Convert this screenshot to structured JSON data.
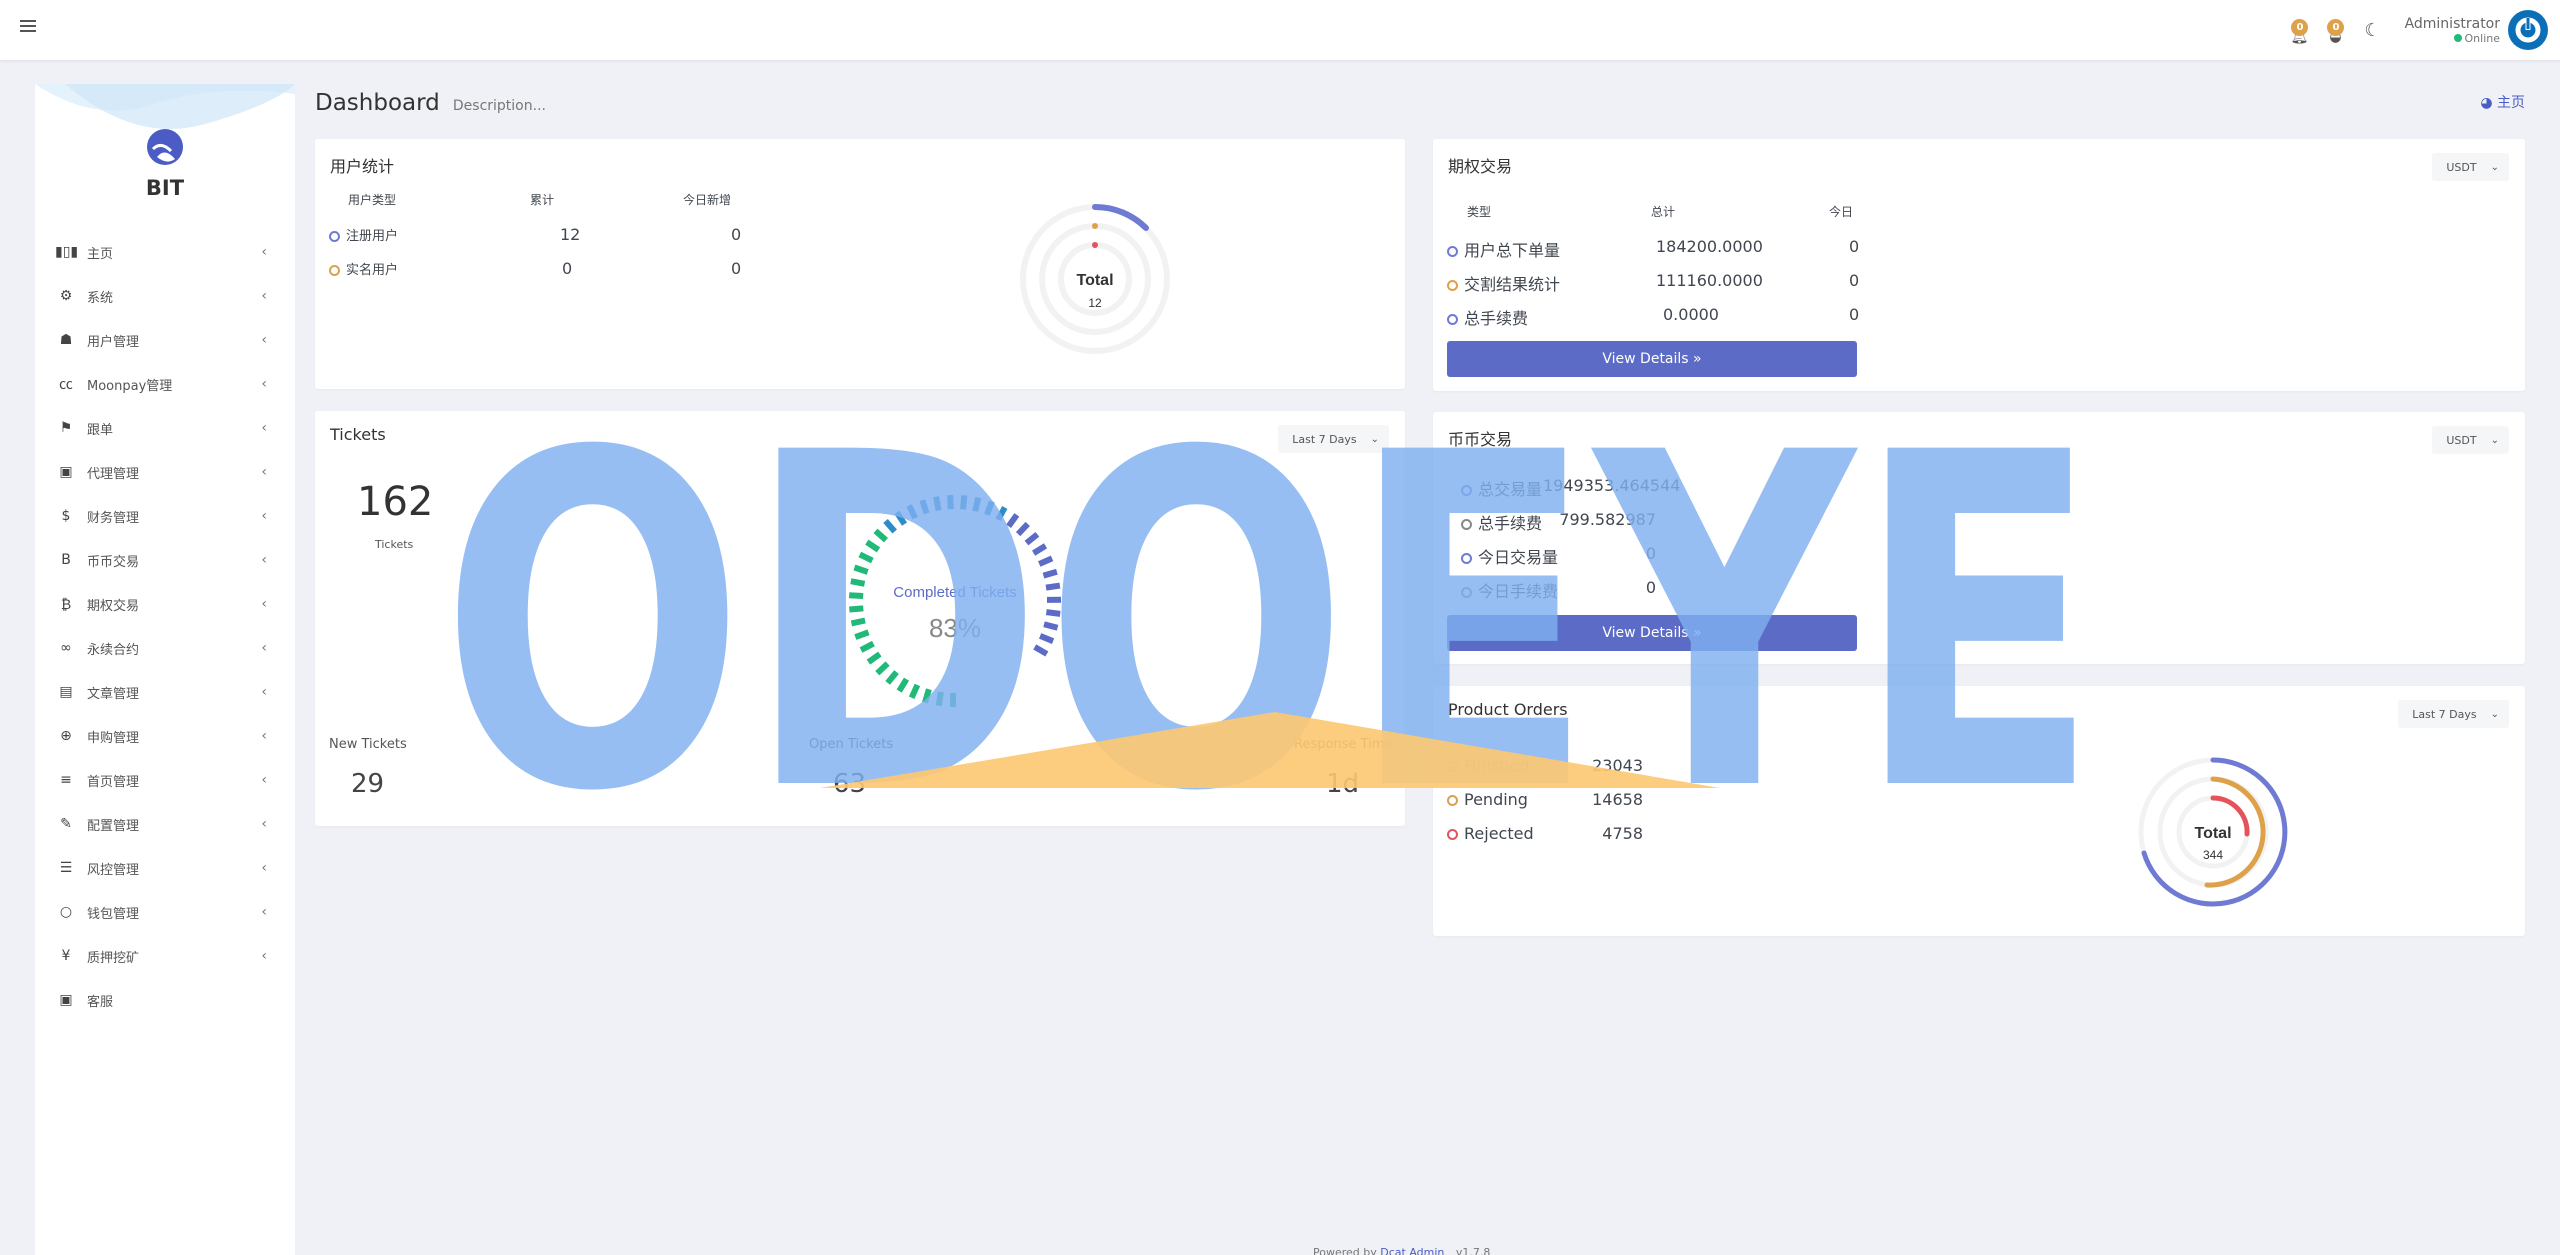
{
  "navbar": {
    "notifications_count": "0",
    "messages_count": "0",
    "user_name": "Administrator",
    "user_status": "Online"
  },
  "sidebar": {
    "brand": "BIT",
    "items": [
      {
        "label": "主页",
        "icon": "bar-chart-icon",
        "glyph": "▮▯▮",
        "has_children": true
      },
      {
        "label": "系统",
        "icon": "gear-icon",
        "glyph": "⚙",
        "has_children": true
      },
      {
        "label": "用户管理",
        "icon": "user-icon",
        "glyph": "☗",
        "has_children": true
      },
      {
        "label": "Moonpay管理",
        "icon": "cc-icon",
        "glyph": "㏄",
        "has_children": true
      },
      {
        "label": "跟单",
        "icon": "flag-icon",
        "glyph": "⚑",
        "has_children": true
      },
      {
        "label": "代理管理",
        "icon": "id-card-icon",
        "glyph": "▣",
        "has_children": true
      },
      {
        "label": "财务管理",
        "icon": "dollar-icon",
        "glyph": "$",
        "has_children": true
      },
      {
        "label": "币币交易",
        "icon": "b-icon",
        "glyph": "B",
        "has_children": true
      },
      {
        "label": "期权交易",
        "icon": "bitcoin-icon",
        "glyph": "₿",
        "has_children": true
      },
      {
        "label": "永续合约",
        "icon": "link-icon",
        "glyph": "∞",
        "has_children": true
      },
      {
        "label": "文章管理",
        "icon": "newspaper-icon",
        "glyph": "▤",
        "has_children": true
      },
      {
        "label": "申购管理",
        "icon": "life-ring-icon",
        "glyph": "⊕",
        "has_children": true
      },
      {
        "label": "首页管理",
        "icon": "bars-icon",
        "glyph": "≡",
        "has_children": true
      },
      {
        "label": "配置管理",
        "icon": "wrench-icon",
        "glyph": "✎",
        "has_children": true
      },
      {
        "label": "风控管理",
        "icon": "indent-icon",
        "glyph": "☰",
        "has_children": true
      },
      {
        "label": "钱包管理",
        "icon": "circle-icon",
        "glyph": "○",
        "has_children": true
      },
      {
        "label": "质押挖矿",
        "icon": "yen-icon",
        "glyph": "¥",
        "has_children": true
      },
      {
        "label": "客服",
        "icon": "contact-card-icon",
        "glyph": "▣",
        "has_children": false
      }
    ]
  },
  "header": {
    "title": "Dashboard",
    "description": "Description...",
    "breadcrumb": "主页"
  },
  "user_stats": {
    "title": "用户统计",
    "columns": [
      "用户类型",
      "累计",
      "今日新增"
    ],
    "rows": [
      {
        "type": "注册用户",
        "total": "12",
        "today": "0",
        "color": "#6f7bd3"
      },
      {
        "type": "实名用户",
        "total": "0",
        "today": "0",
        "color": "#dda14a"
      }
    ],
    "chart_label": "Total",
    "chart_total": "12"
  },
  "options_trading": {
    "title": "期权交易",
    "currency": "USDT",
    "columns": [
      "类型",
      "总计",
      "今日"
    ],
    "rows": [
      {
        "type": "用户总下单量",
        "total": "184200.0000",
        "today": "0"
      },
      {
        "type": "交割结果统计",
        "total": "111160.0000",
        "today": "0"
      },
      {
        "type": "总手续费",
        "total": "0.0000",
        "today": "0"
      }
    ],
    "button": "View Details »"
  },
  "tickets": {
    "title": "Tickets",
    "range": "Last 7 Days",
    "total": "162",
    "total_label": "Tickets",
    "completed_label": "Completed Tickets",
    "completed_pct": "83%",
    "completed_value": 0.83,
    "new_label": "New Tickets",
    "new_value": "29",
    "open_label": "Open Tickets",
    "open_value": "63",
    "response_label": "Response Time",
    "response_value": "1d"
  },
  "spot_trading": {
    "title": "币币交易",
    "currency": "USDT",
    "rows": [
      {
        "label": "总交易量",
        "value": "1949353.464544"
      },
      {
        "label": "总手续费",
        "value": "799.582987"
      },
      {
        "label": "今日交易量",
        "value": "0"
      },
      {
        "label": "今日手续费",
        "value": "0"
      }
    ],
    "button": "View Details »"
  },
  "product_orders": {
    "title": "Product Orders",
    "range": "Last 7 Days",
    "rows": [
      {
        "label": "Finished",
        "value": "23043"
      },
      {
        "label": "Pending",
        "value": "14658"
      },
      {
        "label": "Rejected",
        "value": "4758"
      }
    ],
    "chart_label": "Total",
    "chart_total": "344"
  },
  "footer": {
    "prefix": "Powered by",
    "link": "Dcat Admin",
    "version": "v1.7.8"
  },
  "overlay": {
    "watermark": "ODOEYE"
  }
}
